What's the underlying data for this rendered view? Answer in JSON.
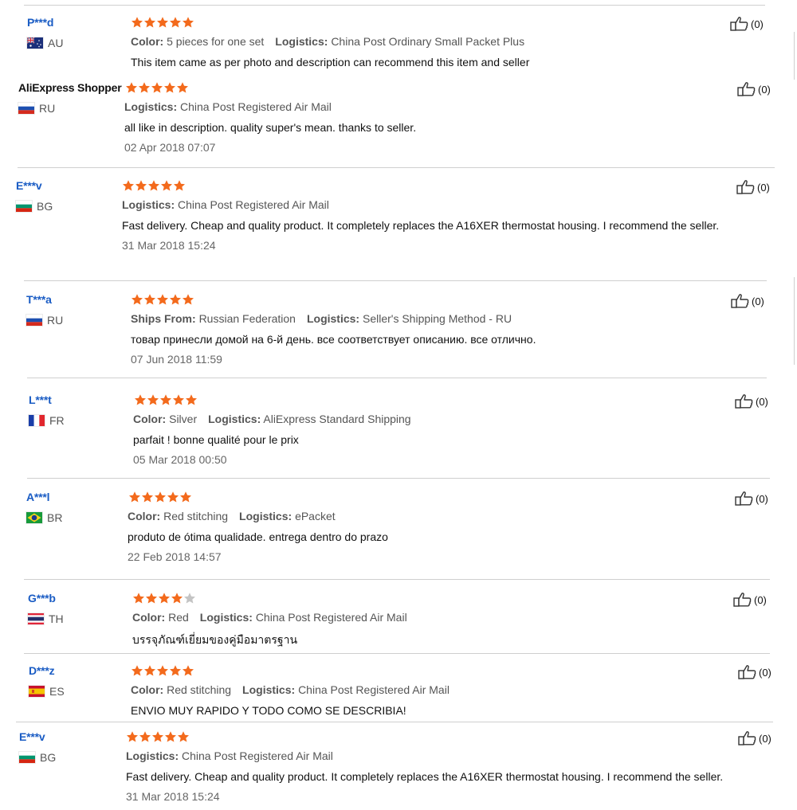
{
  "colors": {
    "star_on": "#f36a1c",
    "star_off": "#c4c4c4",
    "username": "#1a5cc4"
  },
  "reviews": [
    {
      "user": "P***d",
      "country": "AU",
      "flag": "flag-au",
      "rating": 5,
      "meta": [
        {
          "label": "Color:",
          "value": "5 pieces for one set"
        },
        {
          "label": "Logistics:",
          "value": "China Post Ordinary Small Packet Plus"
        }
      ],
      "text": "This item came as per photo and description can recommend this item and seller",
      "date": "",
      "likes": "(0)"
    },
    {
      "user": "AliExpress Shopper",
      "country": "RU",
      "flag": "flag-ru",
      "rating": 5,
      "meta": [
        {
          "label": "Logistics:",
          "value": "China Post Registered Air Mail"
        }
      ],
      "text": "all like in description. quality super's mean. thanks to seller.",
      "date": "02 Apr 2018 07:07",
      "likes": "(0)"
    },
    {
      "user": "E***v",
      "country": "BG",
      "flag": "flag-bg",
      "rating": 5,
      "meta": [
        {
          "label": "Logistics:",
          "value": "China Post Registered Air Mail"
        }
      ],
      "text": "Fast delivery. Cheap and quality product. It completely replaces the A16XER thermostat housing. I recommend the seller.",
      "date": "31 Mar 2018 15:24",
      "likes": "(0)"
    },
    {
      "user": "T***a",
      "country": "RU",
      "flag": "flag-ru",
      "rating": 5,
      "meta": [
        {
          "label": "Ships From:",
          "value": "Russian Federation"
        },
        {
          "label": "Logistics:",
          "value": "Seller's Shipping Method - RU"
        }
      ],
      "text": "товар принесли домой на 6-й день. все соответствует описанию. все отлично.",
      "date": "07 Jun 2018 11:59",
      "likes": "(0)"
    },
    {
      "user": "L***t",
      "country": "FR",
      "flag": "flag-fr",
      "rating": 5,
      "meta": [
        {
          "label": "Color:",
          "value": "Silver"
        },
        {
          "label": "Logistics:",
          "value": "AliExpress Standard Shipping"
        }
      ],
      "text": "parfait ! bonne qualité pour le prix",
      "date": "05 Mar 2018 00:50",
      "likes": "(0)"
    },
    {
      "user": "A***l",
      "country": "BR",
      "flag": "flag-br",
      "rating": 5,
      "meta": [
        {
          "label": "Color:",
          "value": "Red stitching"
        },
        {
          "label": "Logistics:",
          "value": "ePacket"
        }
      ],
      "text": "produto de ótima qualidade. entrega dentro do prazo",
      "date": "22 Feb 2018 14:57",
      "likes": "(0)"
    },
    {
      "user": "G***b",
      "country": "TH",
      "flag": "flag-th",
      "rating": 4,
      "meta": [
        {
          "label": "Color:",
          "value": "Red"
        },
        {
          "label": "Logistics:",
          "value": "China Post Registered Air Mail"
        }
      ],
      "text": "บรรจุภัณฑ์เยี่ยมของคู่มือมาตรฐาน",
      "date": "",
      "likes": "(0)"
    },
    {
      "user": "D***z",
      "country": "ES",
      "flag": "flag-es",
      "rating": 5,
      "meta": [
        {
          "label": "Color:",
          "value": "Red stitching"
        },
        {
          "label": "Logistics:",
          "value": "China Post Registered Air Mail"
        }
      ],
      "text": "ENVIO MUY RAPIDO Y TODO COMO SE DESCRIBIA!",
      "date": "",
      "likes": "(0)"
    },
    {
      "user": "E***v",
      "country": "BG",
      "flag": "flag-bg",
      "rating": 5,
      "meta": [
        {
          "label": "Logistics:",
          "value": "China Post Registered Air Mail"
        }
      ],
      "text": "Fast delivery. Cheap and quality product. It completely replaces the A16XER thermostat housing. I recommend the seller.",
      "date": "31 Mar 2018 15:24",
      "likes": "(0)"
    }
  ]
}
